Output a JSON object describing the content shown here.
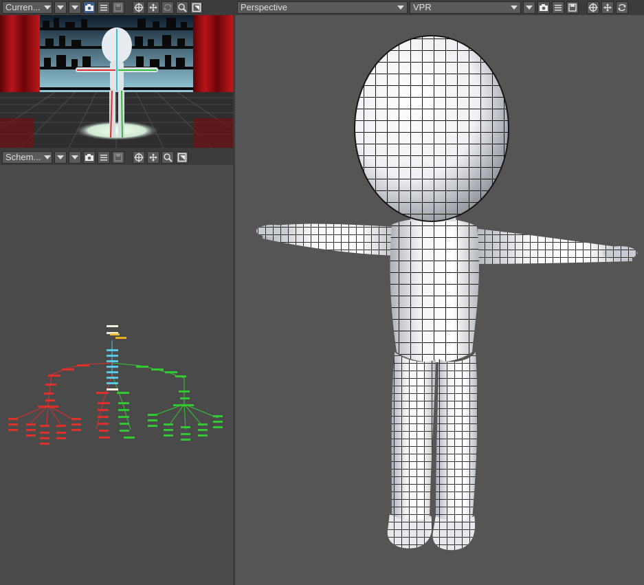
{
  "top_left": {
    "view_label": "Curren...",
    "buttons": [
      "dropdown-icon",
      "display-mode-icon",
      "camera-icon",
      "options-list-icon",
      "save-icon",
      "move-icon",
      "pan-icon",
      "rotate-icon",
      "zoom-icon",
      "maximize-icon"
    ]
  },
  "bottom_left": {
    "view_label": "Schem...",
    "buttons": [
      "dropdown-icon",
      "display-mode-icon",
      "camera-icon",
      "options-list-icon",
      "save-icon",
      "move-icon",
      "pan-icon",
      "zoom-icon",
      "maximize-icon"
    ]
  },
  "main": {
    "view_label": "Perspective",
    "render_mode": "VPR"
  },
  "colors": {
    "panel_bg": "#4a4a4a",
    "toolbar_bg": "#3c3c3c",
    "active_button": "#3d5f87",
    "schematic_red": "#e0302a",
    "schematic_green": "#34c734",
    "schematic_cyan": "#58c8e8",
    "schematic_yellow": "#e8c040"
  }
}
